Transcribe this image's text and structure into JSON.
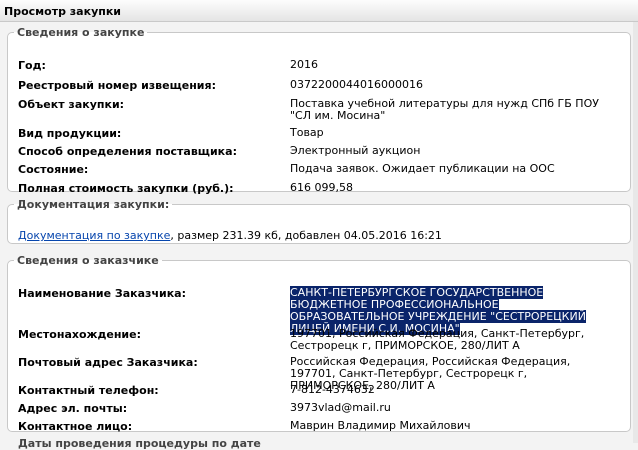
{
  "window": {
    "title": "Просмотр закупки"
  },
  "purchase": {
    "legend": "Сведения о закупке",
    "rows": [
      {
        "label": "Год:",
        "value": "2016"
      },
      {
        "label": "Реестровый номер извещения:",
        "value": "0372200044016000016"
      },
      {
        "label": "Объект закупки:",
        "value": "Поставка учебной литературы для нужд СПб ГБ ПОУ \"СЛ им. Мосина\""
      },
      {
        "label": "Вид продукции:",
        "value": "Товар"
      },
      {
        "label": "Способ определения поставщика:",
        "value": "Электронный аукцион"
      },
      {
        "label": "Состояние:",
        "value": "Подача заявок. Ожидает публикации на ООС"
      },
      {
        "label": "Полная стоимость закупки (руб.):",
        "value": "616 099,58"
      }
    ]
  },
  "documentation": {
    "legend": "Документация закупки:",
    "link": "Документация по закупке",
    "info": ", размер 231.39 кб, добавлен 04.05.2016 16:21"
  },
  "customer": {
    "legend": "Сведения о заказчике",
    "rows": [
      {
        "label": "Наименование Заказчика:",
        "value": "САНКТ-ПЕТЕРБУРГСКОЕ ГОСУДАРСТВЕННОЕ БЮДЖЕТНОЕ ПРОФЕССИОНАЛЬНОЕ ОБРАЗОВАТЕЛЬНОЕ УЧРЕЖДЕНИЕ \"СЕСТРОРЕЦКИЙ ЛИЦЕЙ ИМЕНИ С.И. МОСИНА\""
      },
      {
        "label": "Местонахождение:",
        "value": "197701, Российская Федерация, Санкт-Петербург, Сестрорецк г, ПРИМОРСКОЕ, 280/ЛИТ А"
      },
      {
        "label": "Почтовый адрес Заказчика:",
        "value": "Российская Федерация, Российская Федерация, 197701, Санкт-Петербург, Сестрорецк г, ПРИМОРСКОЕ, 280/ЛИТ А"
      },
      {
        "label": "Контактный телефон:",
        "value": "7-812-4374632"
      },
      {
        "label": "Адрес эл. почты:",
        "value": "3973vlad@mail.ru"
      },
      {
        "label": "Контактное лицо:",
        "value": "Маврин Владимир Михайлович"
      }
    ]
  },
  "next_section": {
    "legend": "Даты проведения процедуры по дате"
  }
}
